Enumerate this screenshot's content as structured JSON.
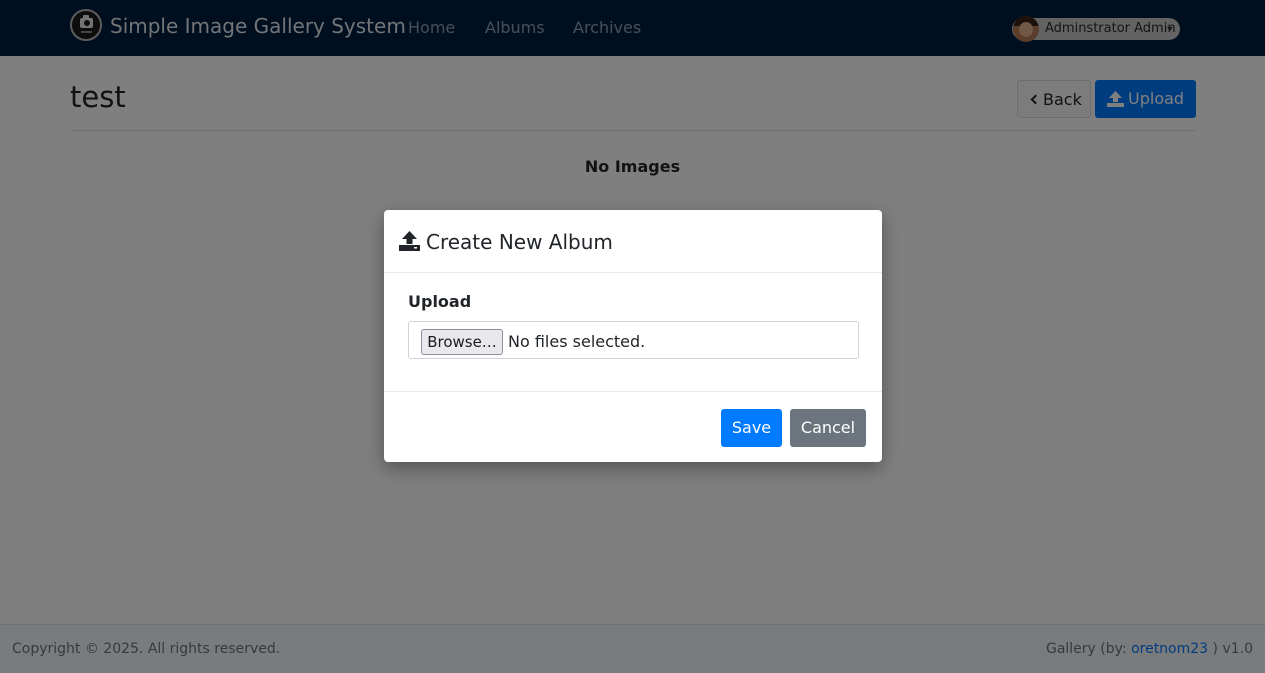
{
  "navbar": {
    "brand": "Simple Image Gallery System",
    "links": [
      "Home",
      "Albums",
      "Archives"
    ],
    "user_name": "Adminstrator Admin"
  },
  "page": {
    "title": "test",
    "back_label": "Back",
    "upload_label": "Upload",
    "empty_message": "No Images"
  },
  "modal": {
    "title": "Create New Album",
    "field_label": "Upload",
    "browse_label": "Browse…",
    "file_status": "No files selected.",
    "save_label": "Save",
    "cancel_label": "Cancel"
  },
  "footer": {
    "copyright": "Copyright © 2025. All rights reserved.",
    "credit_prefix": "Gallery (by: ",
    "author": "oretnom23",
    "credit_suffix": " ) v1.0"
  },
  "colors": {
    "navbar": "#001f3f",
    "primary": "#007bff",
    "secondary": "#6c757d"
  },
  "icons": [
    "camera-logo-icon",
    "avatar-icon",
    "chevron-left-icon",
    "upload-icon",
    "chevron-down-icon"
  ]
}
